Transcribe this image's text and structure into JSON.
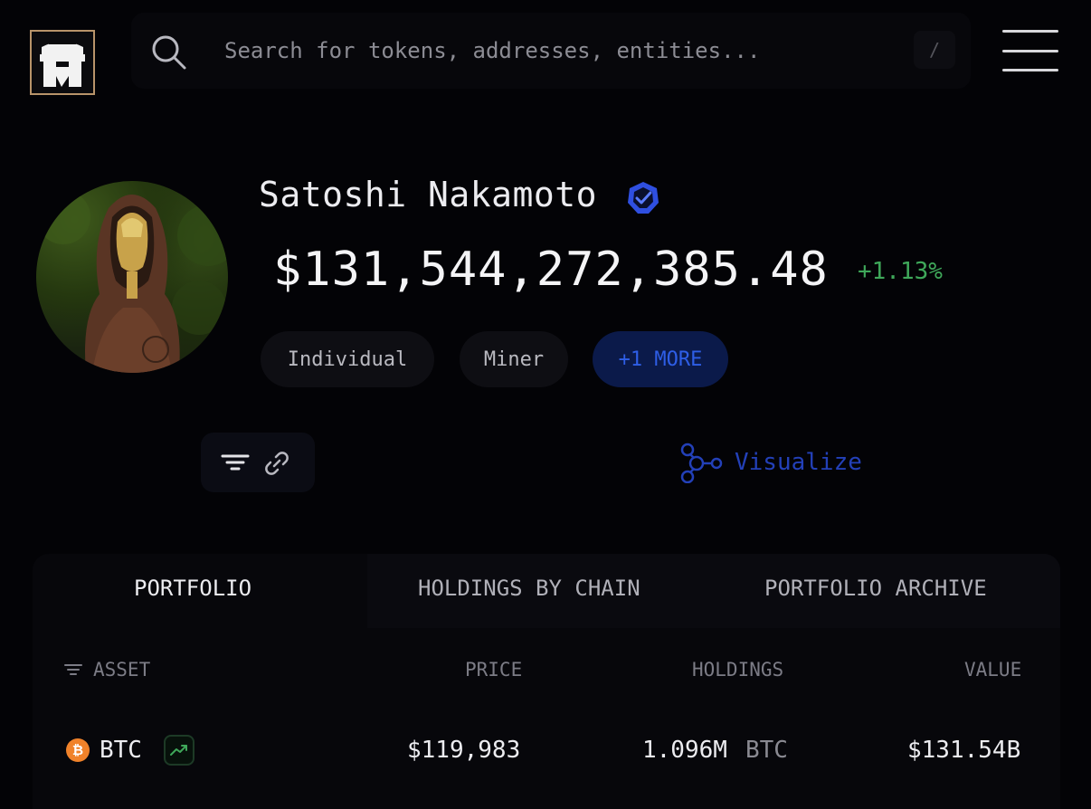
{
  "header": {
    "search_placeholder": "Search for tokens, addresses, entities...",
    "search_shortcut": "/"
  },
  "profile": {
    "name": "Satoshi Nakamoto",
    "balance": "$131,544,272,385.48",
    "change": "+1.13%",
    "tags": [
      "Individual",
      "Miner",
      "+1 MORE"
    ]
  },
  "toolbar": {
    "visualize_label": "Visualize"
  },
  "tabs": [
    "PORTFOLIO",
    "HOLDINGS BY CHAIN",
    "PORTFOLIO ARCHIVE"
  ],
  "table": {
    "columns": [
      "ASSET",
      "PRICE",
      "HOLDINGS",
      "VALUE"
    ],
    "rows": [
      {
        "asset": "BTC",
        "icon_glyph": "₿",
        "price": "$119,983",
        "holdings": "1.096M",
        "holdings_unit": "BTC",
        "value": "$131.54B"
      }
    ]
  },
  "colors": {
    "background": "#030306",
    "positive": "#3fa85a",
    "accent_blue": "#2340b8",
    "btc_orange": "#f0822a",
    "logo_border": "#b8946a"
  }
}
